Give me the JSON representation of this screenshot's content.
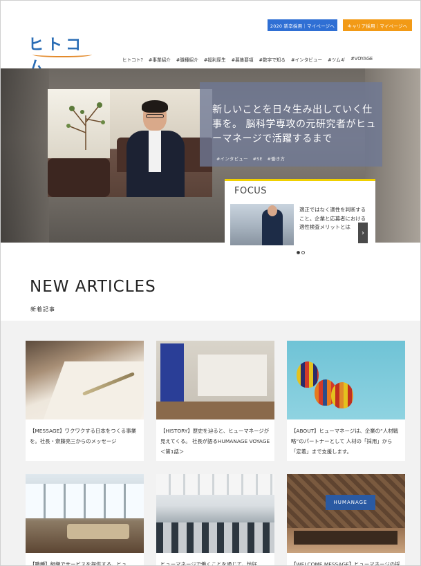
{
  "header": {
    "logo_text": "ヒトコム",
    "btn_new_grad": "2020 新卒採用｜マイページへ",
    "btn_career": "キャリア採用｜マイページへ",
    "nav": [
      "ヒトコト?",
      "#事業紹介",
      "#職種紹介",
      "#福利厚生",
      "#募集要項",
      "#数字で知る",
      "#インタビュー",
      "#ツムギ",
      "#VOYAGE"
    ]
  },
  "hero": {
    "title": "新しいことを日々生み出していく仕事を。 脳科学専攻の元研究者がヒューマネージで活躍するまで",
    "tags": "#インタビュー　#SE　#働き方",
    "focus_label": "FOCUS",
    "focus_text": "適正ではなく適性を判断すること。企業と応募者における適性検査メリットとは",
    "arrow": "›"
  },
  "articles": {
    "title": "NEW ARTICLES",
    "subtitle": "新着記事",
    "items": [
      "【MESSAGE】ワクワクする日本をつくる事業を。社長・齋藤亮三からのメッセージ",
      "【HISTORY】歴史を辿ると、ヒューマネージが見えてくる。 社長が語るHUMANAGE VOYAGE＜第1話＞",
      "【ABOUT】ヒューマネージは、企業の“人材戦略”のパートナーとして 人材の「採用」から「定着」まで支援します。",
      "【職種】組織でサービスを提供する、ヒュ",
      "ヒューマネージで働くことを通じて、恰好",
      "【WELCOME MESSAGE】ヒューマネージの採"
    ],
    "welcome_sign": "HUMANAGE"
  }
}
